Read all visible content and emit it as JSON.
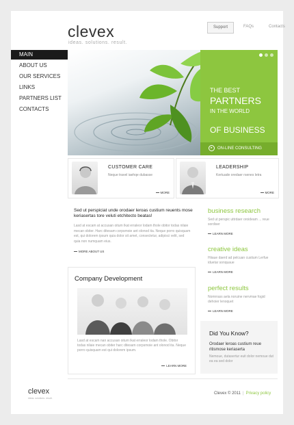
{
  "header": {
    "logo": "clevex",
    "tagline": "ideas. solutions. result.",
    "top_nav": [
      "Support",
      "FAQs",
      "Contacts"
    ]
  },
  "sidebar": {
    "items": [
      "MAIN",
      "ABOUT US",
      "OUR SERVICES",
      "LINKS",
      "PARTNERS LIST",
      "CONTACTS"
    ]
  },
  "hero": {
    "line1": "THE BEST",
    "line2": "PARTNERS",
    "line3": "IN THE WORLD",
    "line4": "OF BUSINESS",
    "consult_label": "ON-LINE CONSULTING",
    "consult_icon": "arrow-circle-icon"
  },
  "cards": [
    {
      "title": "CUSTOMER CARE",
      "text": "Neque travel iaehqe dubasse",
      "more": "MORE"
    },
    {
      "title": "LEADERSHIP",
      "text": "Kertuade oredaer rsenes letra",
      "more": "MORE"
    }
  ],
  "intro": {
    "title": "Sed ut perspiciat unde orodaer leroas custium reuents mose keriasertas tore veluti etchitecto beatas!",
    "text": "Lasd at escam at accusan oitum lkat erraleor lodam thole obitor todas nilaie mecan obiter. Harc ditesam corpsmoie ant olonod ita. Neque porro quisquam est, qui dolorem ipsum quia dolor sit amet, consectetur, adipisci velit, sed quia non numquam eius.",
    "more": "MORE ABOUT US"
  },
  "company": {
    "title": "Company Development",
    "text": "Lasd at escam nan accusan oitum lkat erraleor lodam thole. Obitor todas nilaie mecan obiter harc ditesam corpsmoie ant olonod ita. Neque porro quisquam est qui dolorem ipsum.",
    "more": "LEARN MORE"
  },
  "side_blocks": [
    {
      "title": "business research",
      "text": "Sed ut perspic uttrdaer oroideam ... reue sordiser",
      "more": "LEARN MORE"
    },
    {
      "title": "creative ideas",
      "text": "Hiiaue daerd ad pelcuan custium Lerfue iduetar sonquaue",
      "more": "LEARN MORE"
    },
    {
      "title": "perfect results",
      "text": "Nomrrass aela noruine nervmae fogid dehoier lenoquet",
      "more": "LEARN MORE"
    }
  ],
  "did_you_know": {
    "title": "Did You Know?",
    "bold": "Orodaer leroas custium reue ritismose keriaserta",
    "small": "Nemoue, dutasertur euit dolor nemoue dut ea ea sed dolor"
  },
  "footer": {
    "logo": "clevex",
    "tagline": "ideas. solutions. result.",
    "copyright": "Clevex © 2011",
    "separator": "|",
    "privacy": "Privacy policy"
  },
  "colors": {
    "accent": "#8dc63f",
    "accent_dark": "#76ad2c",
    "nav_active": "#1a1a1a"
  }
}
